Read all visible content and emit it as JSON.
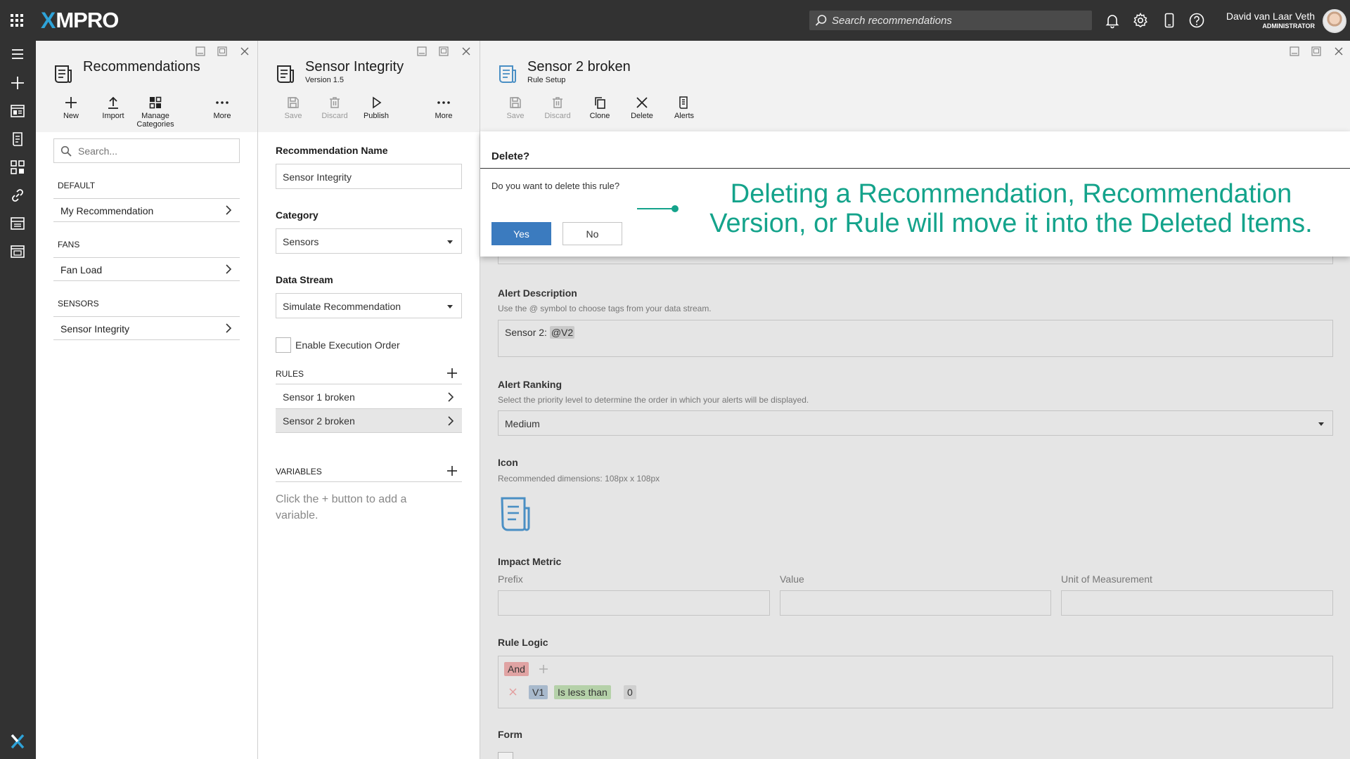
{
  "topbar": {
    "brand_x": "X",
    "brand_rest": "MPRO",
    "search_placeholder": "Search recommendations",
    "user_name": "David van Laar Veth",
    "user_role": "ADMINISTRATOR"
  },
  "rail": {
    "icons": [
      "menu-icon",
      "add-icon",
      "dashboard-icon",
      "recommendations-icon",
      "apps-icon",
      "link-icon",
      "data-stream-icon",
      "calendar-icon",
      "xmpro-logo-icon"
    ]
  },
  "pane1": {
    "title": "Recommendations",
    "toolbar": {
      "new": "New",
      "import": "Import",
      "manage_line1": "Manage",
      "manage_line2": "Categories",
      "more": "More"
    },
    "search_placeholder": "Search...",
    "groups": [
      {
        "name": "DEFAULT",
        "items": [
          "My Recommendation"
        ]
      },
      {
        "name": "FANS",
        "items": [
          "Fan Load"
        ]
      },
      {
        "name": "SENSORS",
        "items": [
          "Sensor Integrity"
        ]
      }
    ]
  },
  "pane2": {
    "title": "Sensor Integrity",
    "subtitle": "Version 1.5",
    "toolbar": {
      "save": "Save",
      "discard": "Discard",
      "publish": "Publish",
      "more": "More"
    },
    "name_label": "Recommendation Name",
    "name_value": "Sensor Integrity",
    "category_label": "Category",
    "category_value": "Sensors",
    "datastream_label": "Data Stream",
    "datastream_value": "Simulate Recommendation",
    "exec_order_label": "Enable Execution Order",
    "rules_header": "RULES",
    "rules": [
      "Sensor 1 broken",
      "Sensor 2 broken"
    ],
    "variables_header": "VARIABLES",
    "variables_hint": "Click the + button to add a variable."
  },
  "pane3": {
    "title": "Sensor 2 broken",
    "subtitle": "Rule Setup",
    "toolbar": {
      "save": "Save",
      "discard": "Discard",
      "clone": "Clone",
      "delete": "Delete",
      "alerts": "Alerts"
    },
    "alert_desc_label": "Alert Description",
    "alert_desc_hint": "Use the @ symbol to choose tags from your data stream.",
    "alert_desc_prefix": "Sensor 2:",
    "alert_desc_tag": "@V2",
    "ranking_label": "Alert Ranking",
    "ranking_hint": "Select the priority level to determine the order in which your alerts will be displayed.",
    "ranking_value": "Medium",
    "icon_label": "Icon",
    "icon_hint": "Recommended dimensions: 108px x 108px",
    "impact_label": "Impact Metric",
    "impact_prefix": "Prefix",
    "impact_value": "Value",
    "impact_unit": "Unit of Measurement",
    "logic_label": "Rule Logic",
    "logic_and": "And",
    "logic_var": "V1",
    "logic_op": "Is less than",
    "logic_val": "0",
    "form_label": "Form"
  },
  "dialog": {
    "title": "Delete?",
    "question": "Do you want to delete this rule?",
    "yes": "Yes",
    "no": "No",
    "callout": "Deleting a Recommendation, Recommendation Version, or Rule will move it into the Deleted Items."
  },
  "colors": {
    "topbar": "#323232",
    "accent": "#3b7bbf",
    "callout": "#14a38b",
    "brand_x": "#2ea3d9"
  }
}
